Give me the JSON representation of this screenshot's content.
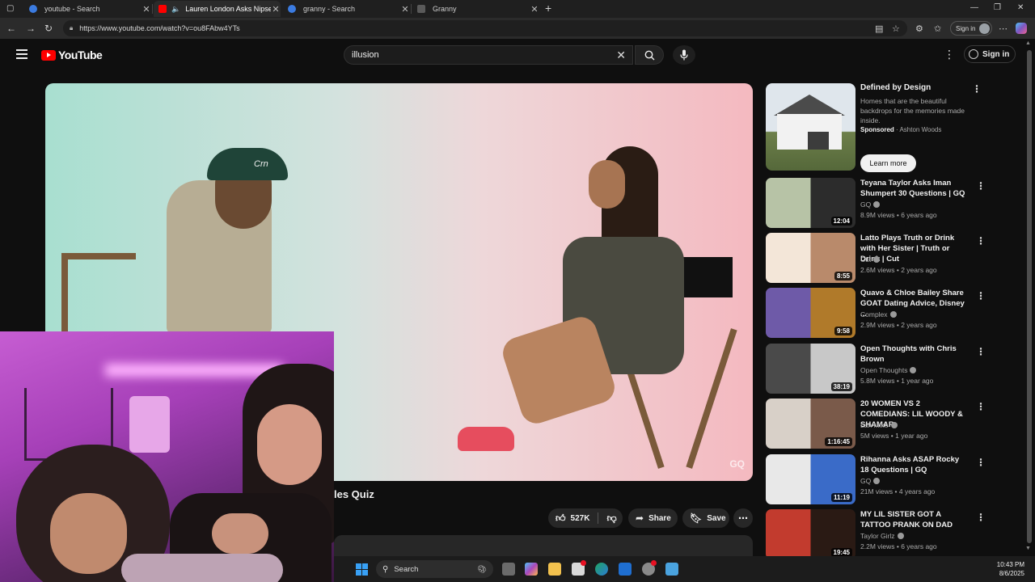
{
  "browser": {
    "tabs": [
      {
        "title": "youtube - Search",
        "close": "✕"
      },
      {
        "title": "Lauren London Asks Nipsey",
        "close": "✕"
      },
      {
        "title": "granny - Search",
        "close": "✕"
      },
      {
        "title": "Granny",
        "close": "✕"
      }
    ],
    "new_tab": "+",
    "url": "https://www.youtube.com/watch?v=ou8FAbw4YTs",
    "sign_in": "Sign in"
  },
  "youtube": {
    "logo_text": "YouTube",
    "search_query": "illusion",
    "sign_in": "Sign in"
  },
  "video": {
    "title_fragment": "les Quiz",
    "watermark": "GQ",
    "likes": "527K",
    "share_label": "Share",
    "save_label": "Save"
  },
  "ad": {
    "title": "Defined by Design",
    "description": "Homes that are the beautiful backdrops for the memories made inside.",
    "sponsored": "Sponsored",
    "advertiser": "Ashton Woods",
    "cta": "Learn more"
  },
  "recommendations": [
    {
      "title": "Teyana Taylor Asks Iman Shumpert 30 Questions | GQ",
      "channel": "GQ",
      "verified": true,
      "views": "8.9M views",
      "age": "6 years ago",
      "duration": "12:04",
      "colors": [
        "#b7c3a6",
        "#2c2c2c"
      ]
    },
    {
      "title": "Latto Plays Truth or Drink with Her Sister | Truth or Drink | Cut",
      "channel": "Cut",
      "verified": true,
      "views": "2.6M views",
      "age": "2 years ago",
      "duration": "8:55",
      "colors": [
        "#f3e6d8",
        "#b98a6b"
      ]
    },
    {
      "title": "Quavo & Chloe Bailey Share GOAT Dating Advice, Disney ...",
      "channel": "Complex",
      "verified": true,
      "views": "2.9M views",
      "age": "2 years ago",
      "duration": "9:58",
      "colors": [
        "#6e5aa8",
        "#b07a2a"
      ]
    },
    {
      "title": "Open Thoughts with Chris Brown",
      "channel": "Open Thoughts",
      "verified": true,
      "views": "5.8M views",
      "age": "1 year ago",
      "duration": "38:19",
      "colors": [
        "#4a4a4a",
        "#c8c8c8"
      ]
    },
    {
      "title": "20 WOMEN VS 2 COMEDIANS: LIL WOODY & SHAMAR",
      "channel": "Lah Mike",
      "verified": true,
      "views": "5M views",
      "age": "1 year ago",
      "duration": "1:16:45",
      "colors": [
        "#d8d0c8",
        "#7a5a4a"
      ]
    },
    {
      "title": "Rihanna Asks ASAP Rocky 18 Questions | GQ",
      "channel": "GQ",
      "verified": true,
      "views": "21M views",
      "age": "4 years ago",
      "duration": "11:19",
      "colors": [
        "#e8e8e8",
        "#3a6bc8"
      ]
    },
    {
      "title": "MY LIL SISTER GOT A TATTOO PRANK ON DAD",
      "channel": "Taylor Girlz",
      "verified": true,
      "views": "2.2M views",
      "age": "6 years ago",
      "duration": "19:45",
      "colors": [
        "#c23b2e",
        "#2a1a14"
      ]
    }
  ],
  "taskbar": {
    "search_label": "Search",
    "time": "10:43 PM",
    "date": "8/6/2025"
  }
}
